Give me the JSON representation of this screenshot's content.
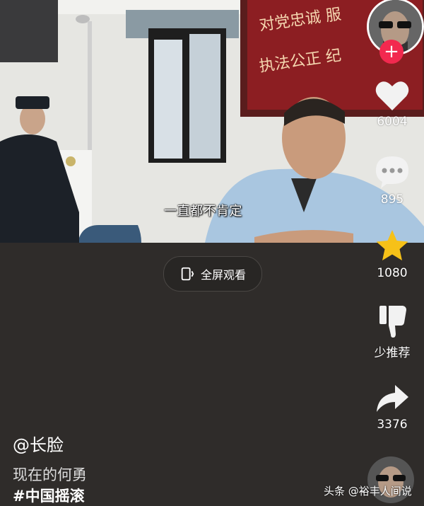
{
  "video": {
    "subtitle": "一直都不肯定",
    "banner_line1": "对党忠诚 服",
    "banner_line2": "执法公正 纪"
  },
  "fullscreen": {
    "label": "全屏观看"
  },
  "actions": {
    "like_count": "6004",
    "comment_count": "895",
    "favorite_count": "1080",
    "less_label": "少推荐",
    "share_count": "3376"
  },
  "caption": {
    "author": "@长脸",
    "description": "现在的何勇",
    "hashtag": "#中国摇滚"
  },
  "watermark": "头条 @裕丰人间说",
  "colors": {
    "background": "#2f2c2a",
    "accent": "#f2294f",
    "star": "#f6c118"
  },
  "icons": [
    "heart-icon",
    "comment-icon",
    "star-icon",
    "thumbs-down-icon",
    "share-icon",
    "plus-icon",
    "fullscreen-icon"
  ]
}
